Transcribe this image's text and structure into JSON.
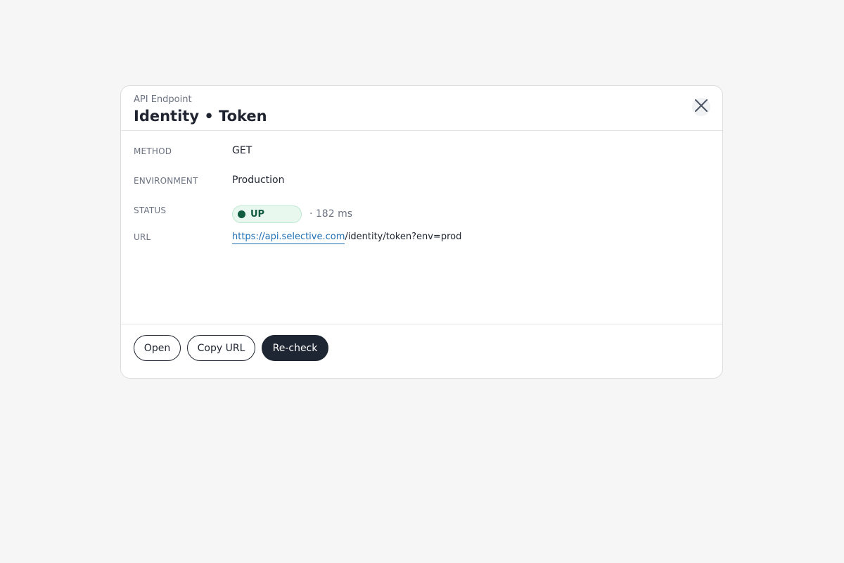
{
  "dialog": {
    "eyebrow": "API Endpoint",
    "title": "Identity • Token",
    "close_icon": "close-icon"
  },
  "fields": {
    "method": {
      "label": "METHOD",
      "value": "GET"
    },
    "environment": {
      "label": "ENVIRONMENT",
      "value": "Production"
    },
    "status": {
      "label": "STATUS",
      "value": "UP",
      "latency": "· 182 ms",
      "color": "#0f5b40"
    },
    "url": {
      "label": "URL",
      "link_text": "https://api.selective.com",
      "path": "/identity/token?env=prod"
    }
  },
  "actions": {
    "open_label": "Open",
    "copy_label": "Copy URL",
    "recheck_label": "Re-check"
  },
  "colors": {
    "accent": "#1f2633",
    "link": "#1f6fb2",
    "status_bg": "#e8f8ef"
  }
}
